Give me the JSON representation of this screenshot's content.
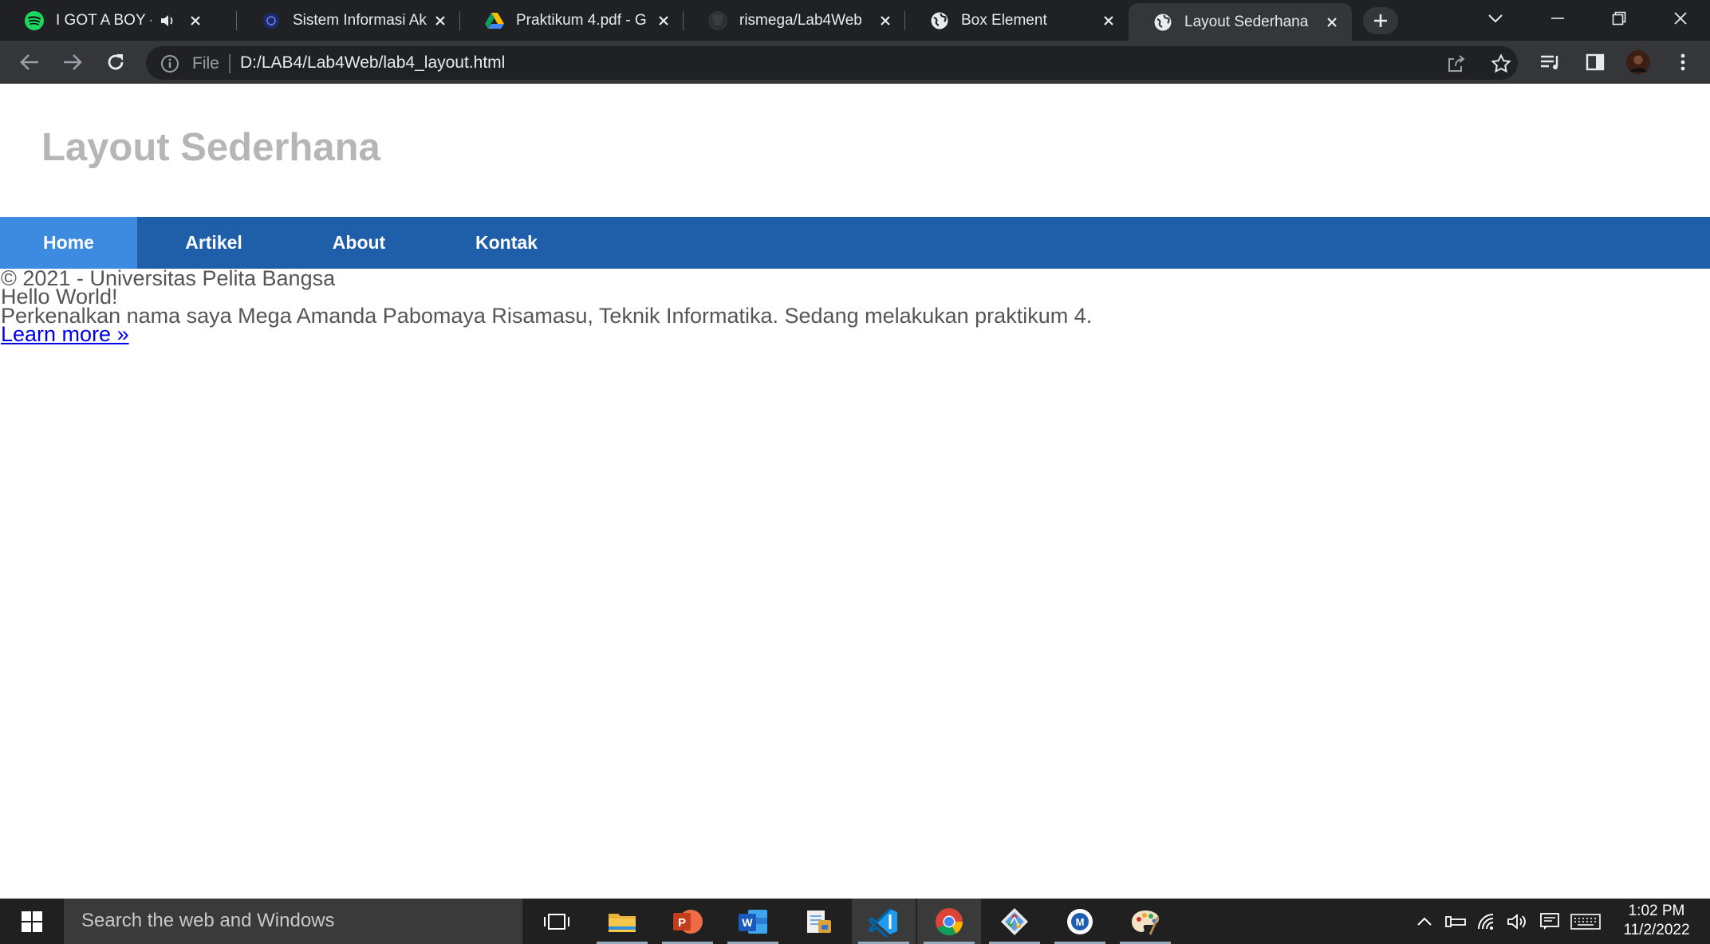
{
  "browser": {
    "tabs": [
      {
        "title": "I GOT A BOY - G",
        "favicon": "spotify-icon",
        "audio": true,
        "active": false
      },
      {
        "title": "Sistem Informasi Ak",
        "favicon": "university-icon",
        "active": false
      },
      {
        "title": "Praktikum 4.pdf - G",
        "favicon": "google-drive-icon",
        "active": false
      },
      {
        "title": "rismega/Lab4Web",
        "favicon": "github-icon",
        "active": false
      },
      {
        "title": "Box Element",
        "favicon": "globe-icon",
        "active": false
      },
      {
        "title": "Layout Sederhana",
        "favicon": "globe-icon",
        "active": true
      }
    ],
    "omnibox": {
      "scheme_label": "File",
      "url": "D:/LAB4/Lab4Web/lab4_layout.html"
    }
  },
  "page": {
    "header_title": "Layout Sederhana",
    "nav": [
      {
        "label": "Home",
        "active": true
      },
      {
        "label": "Artikel",
        "active": false
      },
      {
        "label": "About",
        "active": false
      },
      {
        "label": "Kontak",
        "active": false
      }
    ],
    "footer_text": "© 2021 - Universitas Pelita Bangsa",
    "hello": "Hello World!",
    "intro": "Perkenalkan nama saya Mega Amanda Pabomaya Risamasu, Teknik Informatika. Sedang melakukan praktikum 4.",
    "learn_more": "Learn more »"
  },
  "taskbar": {
    "search_placeholder": "Search the web and Windows",
    "clock_time": "1:02 PM",
    "clock_date": "11/2/2022"
  },
  "colors": {
    "nav_bg": "#1f5faa",
    "nav_active": "#3c8be0",
    "title_gray": "#b6b6b6",
    "link_blue": "#0000ee"
  }
}
